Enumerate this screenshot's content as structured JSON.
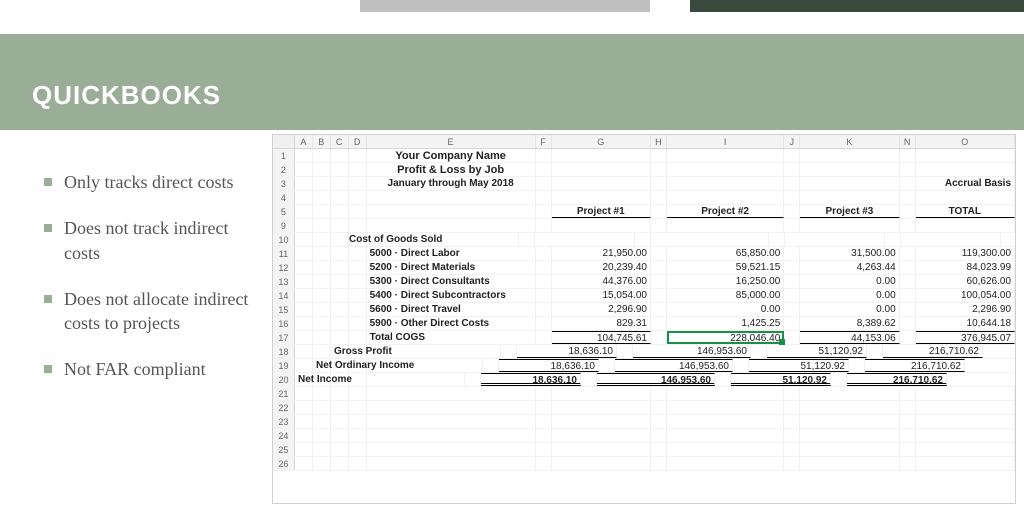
{
  "slide": {
    "title": "QUICKBOOKS",
    "bullets": [
      "Only tracks direct costs",
      "Does not track indirect costs",
      "Does not allocate indirect costs to projects",
      "Not FAR compliant"
    ]
  },
  "spreadsheet": {
    "columns": [
      "A",
      "B",
      "C",
      "D",
      "E",
      "F",
      "G",
      "H",
      "I",
      "J",
      "K",
      "N",
      "O"
    ],
    "row_labels": [
      "1",
      "2",
      "3",
      "4",
      "5",
      "9",
      "10",
      "11",
      "12",
      "13",
      "14",
      "15",
      "16",
      "17",
      "18",
      "19",
      "20",
      "21",
      "22",
      "23",
      "24",
      "25",
      "26"
    ],
    "header": {
      "company": "Your Company Name",
      "report": "Profit & Loss by Job",
      "period": "January through May 2018",
      "basis": "Accrual Basis"
    },
    "project_headers": {
      "g": "Project #1",
      "i": "Project #2",
      "k": "Project #3",
      "o": "TOTAL"
    },
    "cogs_label": "Cost of Goods Sold",
    "lines": [
      {
        "label": "5000 · Direct Labor",
        "g": "21,950.00",
        "i": "65,850.00",
        "k": "31,500.00",
        "o": "119,300.00"
      },
      {
        "label": "5200 · Direct Materials",
        "g": "20,239.40",
        "i": "59,521.15",
        "k": "4,263.44",
        "o": "84,023.99"
      },
      {
        "label": "5300 · Direct Consultants",
        "g": "44,376.00",
        "i": "16,250.00",
        "k": "0.00",
        "o": "60,626.00"
      },
      {
        "label": "5400 · Direct Subcontractors",
        "g": "15,054.00",
        "i": "85,000.00",
        "k": "0.00",
        "o": "100,054.00"
      },
      {
        "label": "5600 · Direct Travel",
        "g": "2,296.90",
        "i": "0.00",
        "k": "0.00",
        "o": "2,296.90"
      },
      {
        "label": "5900 · Other Direct Costs",
        "g": "829.31",
        "i": "1,425.25",
        "k": "8,389.62",
        "o": "10,644.18"
      }
    ],
    "total_cogs": {
      "label": "Total COGS",
      "g": "104,745.61",
      "i": "228,046.40",
      "k": "44,153.06",
      "o": "376,945.07"
    },
    "gross_profit": {
      "label": "Gross Profit",
      "g": "18,636.10",
      "i": "146,953.60",
      "k": "51,120.92",
      "o": "216,710.62"
    },
    "net_ord_inc": {
      "label": "Net Ordinary Income",
      "g": "18,636.10",
      "i": "146,953.60",
      "k": "51,120.92",
      "o": "216,710.62"
    },
    "net_income": {
      "label": "Net Income",
      "g": "18,636.10",
      "i": "146,953.60",
      "k": "51,120.92",
      "o": "216,710.62"
    },
    "selected_cell": "I17"
  }
}
